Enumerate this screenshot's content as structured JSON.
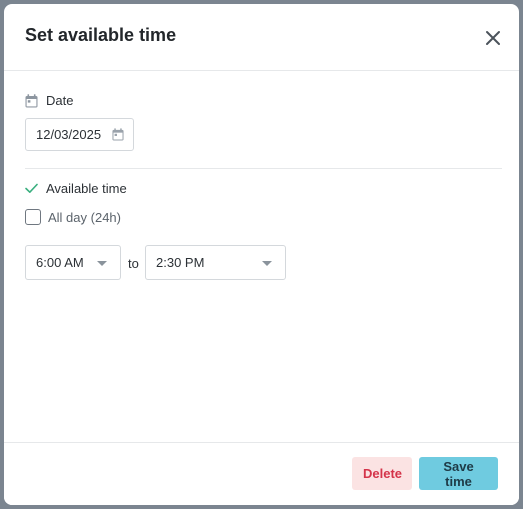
{
  "modal": {
    "title": "Set available time"
  },
  "date": {
    "label": "Date",
    "value": "12/03/2025"
  },
  "available": {
    "label": "Available time",
    "all_day_label": "All day (24h)",
    "all_day_checked": false,
    "start_time": "6:00 AM",
    "separator": "to",
    "end_time": "2:30 PM"
  },
  "footer": {
    "delete_label": "Delete",
    "save_label": "Save time"
  },
  "colors": {
    "accent": "#6fcbe0",
    "danger": "#d4344a",
    "danger_bg": "#fbe3e3",
    "check_green": "#3aaf7f"
  },
  "icons": {
    "close": "close-icon",
    "calendar": "calendar-icon",
    "check": "check-icon",
    "dropdown": "chevron-down-icon"
  }
}
